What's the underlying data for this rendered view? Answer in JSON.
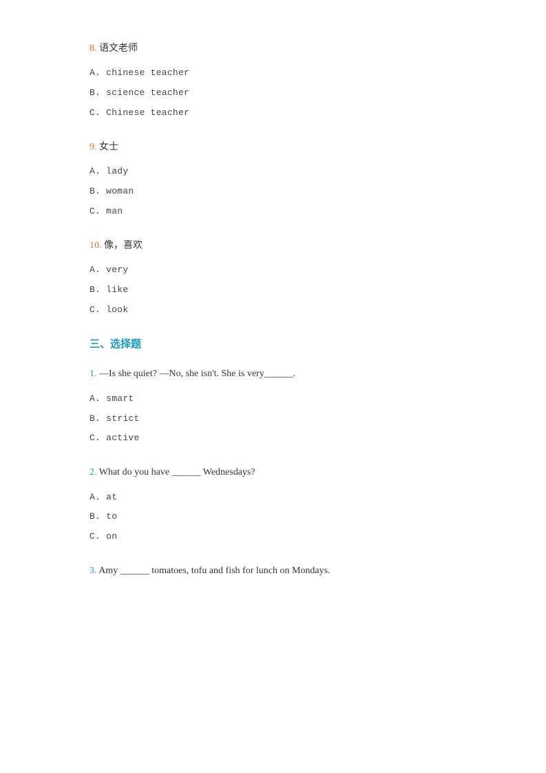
{
  "sections": {
    "vocabulary": {
      "questions": [
        {
          "number": "8.",
          "text": "语文老师",
          "options": [
            "A.  chinese teacher",
            "B.  science teacher",
            "C.  Chinese teacher"
          ]
        },
        {
          "number": "9.",
          "text": "女士",
          "options": [
            "A.  lady",
            "B.  woman",
            "C.  man"
          ]
        },
        {
          "number": "10.",
          "text": "像，喜欢",
          "options": [
            "A.  very",
            "B.  like",
            "C.  look"
          ]
        }
      ]
    },
    "multiple_choice": {
      "heading": "三、选择题",
      "questions": [
        {
          "number": "1.",
          "text": "  —Is she quiet? —No, she isn't. She is very______.",
          "options": [
            "A.  smart",
            "B.  strict",
            "C.  active"
          ]
        },
        {
          "number": "2.",
          "text": "  What do you have ______ Wednesdays?",
          "options": [
            "A.  at",
            "B.  to",
            "C.  on"
          ]
        },
        {
          "number": "3.",
          "text": "  Amy ______ tomatoes, tofu and fish for lunch on Mondays.",
          "options": []
        }
      ]
    }
  }
}
